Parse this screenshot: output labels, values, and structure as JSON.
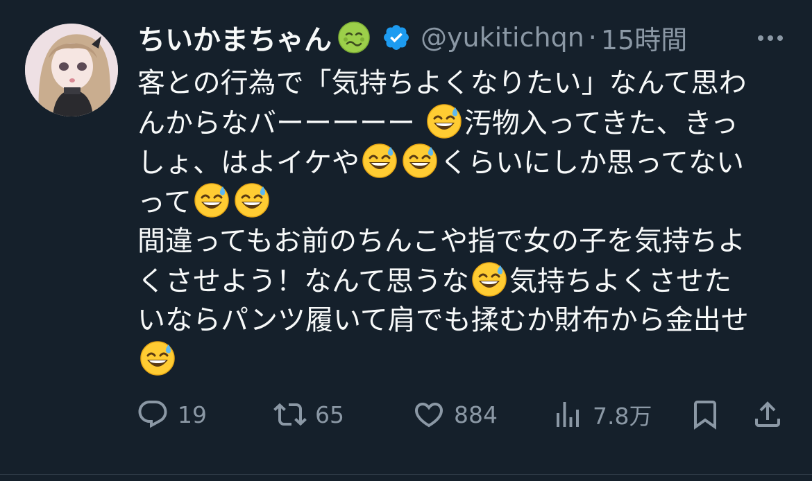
{
  "tweet": {
    "author": {
      "display_name": "ちいかまちゃん",
      "name_emoji": "nauseated-face-emoji",
      "verified": true,
      "handle": "@yukitichqn",
      "separator": "·",
      "time": "15時間"
    },
    "body_lines": [
      [
        "客との行為で「気持ちよくなりたい」なんて思わ"
      ],
      [
        "んからなバーーーーー ",
        "E",
        "汚物入ってきた、きっ"
      ],
      [
        "しょ、はよイケや",
        "E",
        "E",
        "くらいにしか思ってない"
      ],
      [
        "って",
        "E",
        "E"
      ],
      [
        "間違ってもお前のちんこや指で女の子を気持ちよ"
      ],
      [
        "くさせよう！なんて思うな",
        "E",
        "気持ちよくさせた"
      ],
      [
        "いならパンツ履いて肩でも揉むか財布から金出せ"
      ],
      [
        "E"
      ]
    ],
    "body_emoji": "grinning-face-with-sweat-emoji",
    "metrics": {
      "replies": "19",
      "retweets": "65",
      "likes": "884",
      "views": "7.8万"
    }
  },
  "colors": {
    "background": "#15202b",
    "text_primary": "#f7f9f9",
    "text_secondary": "#8b98a5",
    "verified_blue": "#1d9bf0"
  }
}
